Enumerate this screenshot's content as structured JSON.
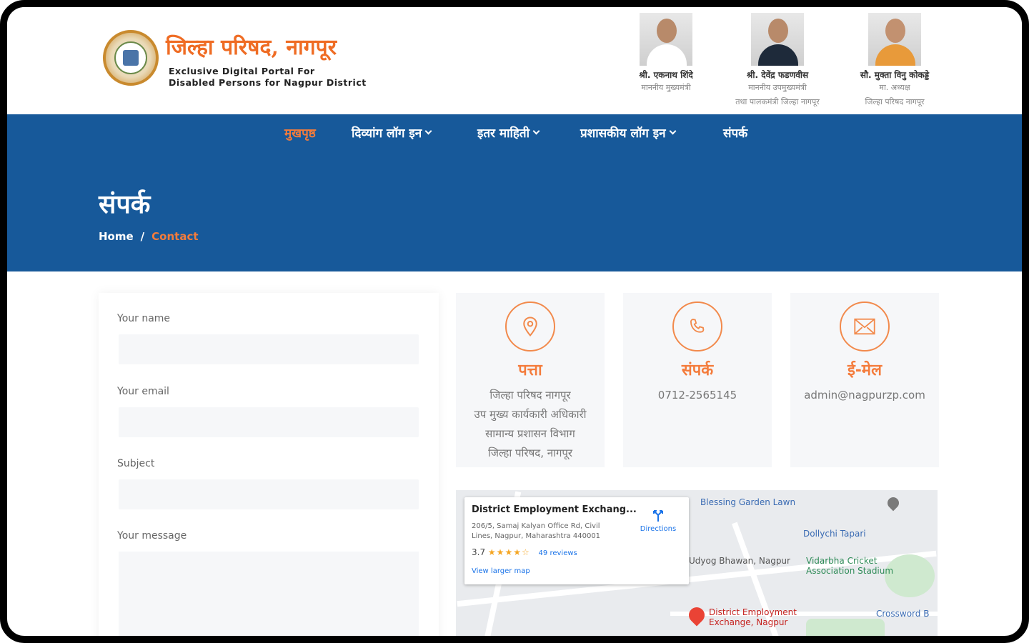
{
  "header": {
    "brand_title": "जिल्हा परिषद, नागपूर",
    "brand_sub_line1": "Exclusive Digital Portal For",
    "brand_sub_line2": "Disabled Persons for Nagpur District",
    "officials": [
      {
        "name": "श्री. एकनाथ शिंदे",
        "role_line1": "माननीय मुख्यमंत्री",
        "role_line2": ""
      },
      {
        "name": "श्री. देवेंद्र फडणवीस",
        "role_line1": "माननीय उपमुख्यमंत्री",
        "role_line2": "तथा पालकमंत्री जिल्हा नागपूर"
      },
      {
        "name": "सौ. मुक्ता विनु कोकड्डे",
        "role_line1": "मा. अध्यक्ष",
        "role_line2": "जिल्हा परिषद नागपूर"
      }
    ]
  },
  "nav": {
    "items": [
      {
        "label": "मुखपृष्ठ",
        "active": true,
        "dropdown": false
      },
      {
        "label": "दिव्यांग लॉग इन",
        "active": false,
        "dropdown": true
      },
      {
        "label": "इतर माहिती",
        "active": false,
        "dropdown": true
      },
      {
        "label": "प्रशासकीय लॉग इन",
        "active": false,
        "dropdown": true
      },
      {
        "label": "संपर्क",
        "active": false,
        "dropdown": false
      }
    ]
  },
  "hero": {
    "title": "संपर्क",
    "breadcrumb_home": "Home",
    "breadcrumb_sep": "/",
    "breadcrumb_current": "Contact"
  },
  "form": {
    "name_label": "Your name",
    "email_label": "Your email",
    "subject_label": "Subject",
    "message_label": "Your message"
  },
  "info": {
    "address": {
      "title": "पत्ता",
      "line1": "जिल्हा परिषद नागपूर",
      "line2": "उप मुख्य कार्यकारी अधिकारी",
      "line3": "सामान्य प्रशासन विभाग",
      "line4": "जिल्हा परिषद, नागपूर"
    },
    "contact": {
      "title": "संपर्क",
      "phone": "0712-2565145"
    },
    "email": {
      "title": "ई-मेल",
      "address": "admin@nagpurzp.com"
    }
  },
  "map": {
    "popup_title": "District Employment Exchang...",
    "popup_address": "206/5, Samaj Kalyan Office Rd, Civil Lines, Nagpur, Maharashtra 440001",
    "rating": "3.7",
    "stars": "★★★★☆",
    "reviews": "49 reviews",
    "larger_map": "View larger map",
    "directions": "Directions",
    "labels": {
      "garden": "Blessing Garden Lawn",
      "dollychi": "Dollychi Tapari",
      "udyog": "Udyog Bhawan, Nagpur",
      "vidarbha_line1": "Vidarbha Cricket",
      "vidarbha_line2": "Association Stadium",
      "dee_line1": "District Employment",
      "dee_line2": "Exchange, Nagpur",
      "crossword": "Crossword B"
    }
  },
  "colors": {
    "primary_blue": "#17599a",
    "accent_orange": "#f47c3c"
  }
}
